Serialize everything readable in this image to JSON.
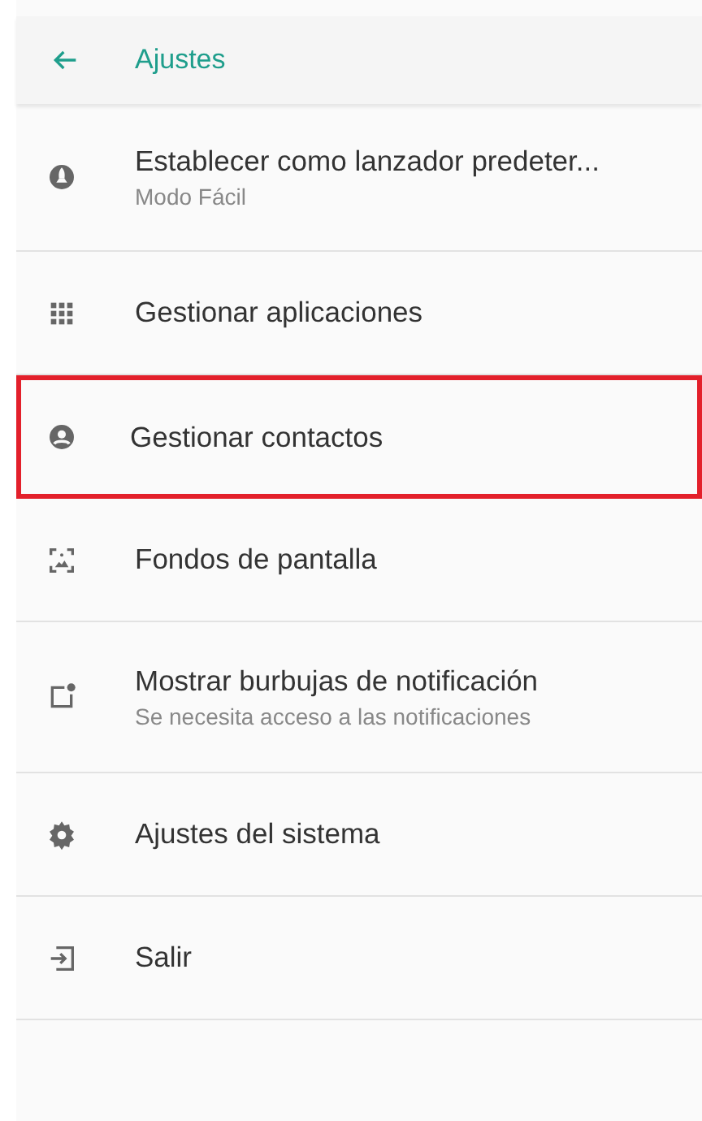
{
  "header": {
    "title": "Ajustes"
  },
  "items": [
    {
      "title": "Establecer como lanzador predeter...",
      "subtitle": "Modo Fácil",
      "highlighted": false
    },
    {
      "title": "Gestionar aplicaciones",
      "highlighted": false
    },
    {
      "title": "Gestionar contactos",
      "highlighted": true
    },
    {
      "title": "Fondos de pantalla",
      "highlighted": false
    },
    {
      "title": "Mostrar burbujas de notificación",
      "subtitle": "Se necesita acceso a las notificaciones",
      "highlighted": false
    },
    {
      "title": "Ajustes del sistema",
      "highlighted": false
    },
    {
      "title": "Salir",
      "highlighted": false
    }
  ]
}
